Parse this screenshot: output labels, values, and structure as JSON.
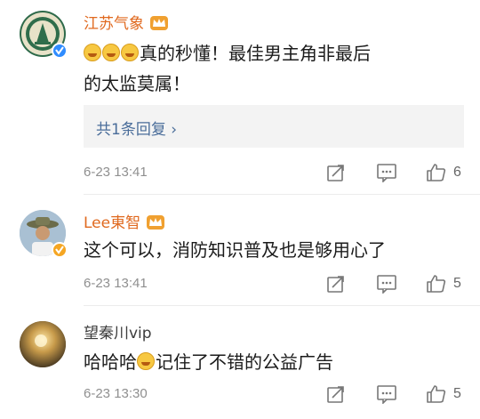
{
  "comments": [
    {
      "username": "江苏气象",
      "text_line1": "真的秒懂！最佳男主角非最后",
      "text_line2": "的太监莫属！",
      "reply_summary": "共1条回复 ›",
      "timestamp": "6-23 13:41",
      "like_count": "6",
      "verified": "blue"
    },
    {
      "username": "Lee東智",
      "text_line1": "这个可以，消防知识普及也是够用心了",
      "timestamp": "6-23 13:41",
      "like_count": "5",
      "verified": "gold"
    },
    {
      "username": "望秦川vip",
      "text_before": "哈哈哈",
      "text_after": "记住了不错的公益广告",
      "timestamp": "6-23 13:30",
      "like_count": "5"
    }
  ],
  "icons": [
    "repost-icon",
    "comment-icon",
    "like-icon",
    "crown-icon",
    "laugh-cry-emoji",
    "grin-emoji"
  ],
  "colors": {
    "username_vip": "#e0691f",
    "reply_link": "#4a6d9a",
    "meta_gray": "#8f8f8f"
  }
}
